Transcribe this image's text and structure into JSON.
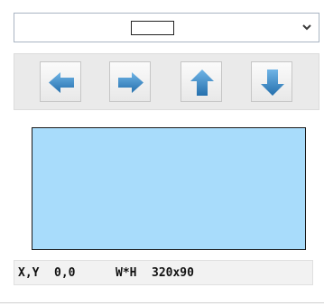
{
  "dropdown": {
    "selected_icon": "rectangle-outline-icon",
    "expand_icon": "chevron-down-icon"
  },
  "toolbar": {
    "buttons": [
      {
        "icon": "arrow-left-icon"
      },
      {
        "icon": "arrow-right-icon"
      },
      {
        "icon": "arrow-up-icon"
      },
      {
        "icon": "arrow-down-icon"
      }
    ]
  },
  "preview": {
    "fill_color": "#a8dcfb",
    "border_color": "#1a1a1a"
  },
  "status": {
    "position_label": "X,Y",
    "position_value": "0,0",
    "size_label": "W*H",
    "size_value": "320x90"
  },
  "colors": {
    "arrow": "#2e7fbf",
    "arrow_light": "#5aa7dd"
  }
}
